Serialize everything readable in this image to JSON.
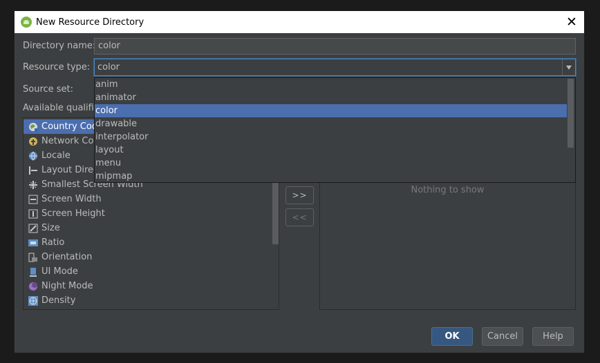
{
  "window": {
    "title": "New Resource Directory",
    "close_glyph": "✕"
  },
  "form": {
    "directory_name_label": "Directory name:",
    "directory_name_value": "color",
    "resource_type_label": "Resource type:",
    "resource_type_value": "color",
    "source_set_label": "Source set:",
    "available_qualifiers_label": "Available qualifiers:"
  },
  "resource_type_options": [
    "anim",
    "animator",
    "color",
    "drawable",
    "interpolator",
    "layout",
    "menu",
    "mipmap"
  ],
  "resource_type_selected_index": 2,
  "qualifiers": [
    {
      "label": "Country Code",
      "icon": "country-code-icon"
    },
    {
      "label": "Network Code",
      "icon": "network-code-icon"
    },
    {
      "label": "Locale",
      "icon": "globe-icon"
    },
    {
      "label": "Layout Direction",
      "icon": "layout-direction-icon"
    },
    {
      "label": "Smallest Screen Width",
      "icon": "smallest-screen-width-icon"
    },
    {
      "label": "Screen Width",
      "icon": "screen-width-icon"
    },
    {
      "label": "Screen Height",
      "icon": "screen-height-icon"
    },
    {
      "label": "Size",
      "icon": "size-icon"
    },
    {
      "label": "Ratio",
      "icon": "ratio-icon"
    },
    {
      "label": "Orientation",
      "icon": "orientation-icon"
    },
    {
      "label": "UI Mode",
      "icon": "ui-mode-icon"
    },
    {
      "label": "Night Mode",
      "icon": "night-mode-icon"
    },
    {
      "label": "Density",
      "icon": "density-icon"
    }
  ],
  "move_buttons": {
    "add": ">>",
    "remove": "<<"
  },
  "chosen_qualifiers": {
    "empty_text": "Nothing to show"
  },
  "buttons": {
    "ok": "OK",
    "cancel": "Cancel",
    "help": "Help"
  },
  "colors": {
    "background": "#3c3f41",
    "selection": "#4b6eaf",
    "focus_border": "#4a88c7"
  }
}
